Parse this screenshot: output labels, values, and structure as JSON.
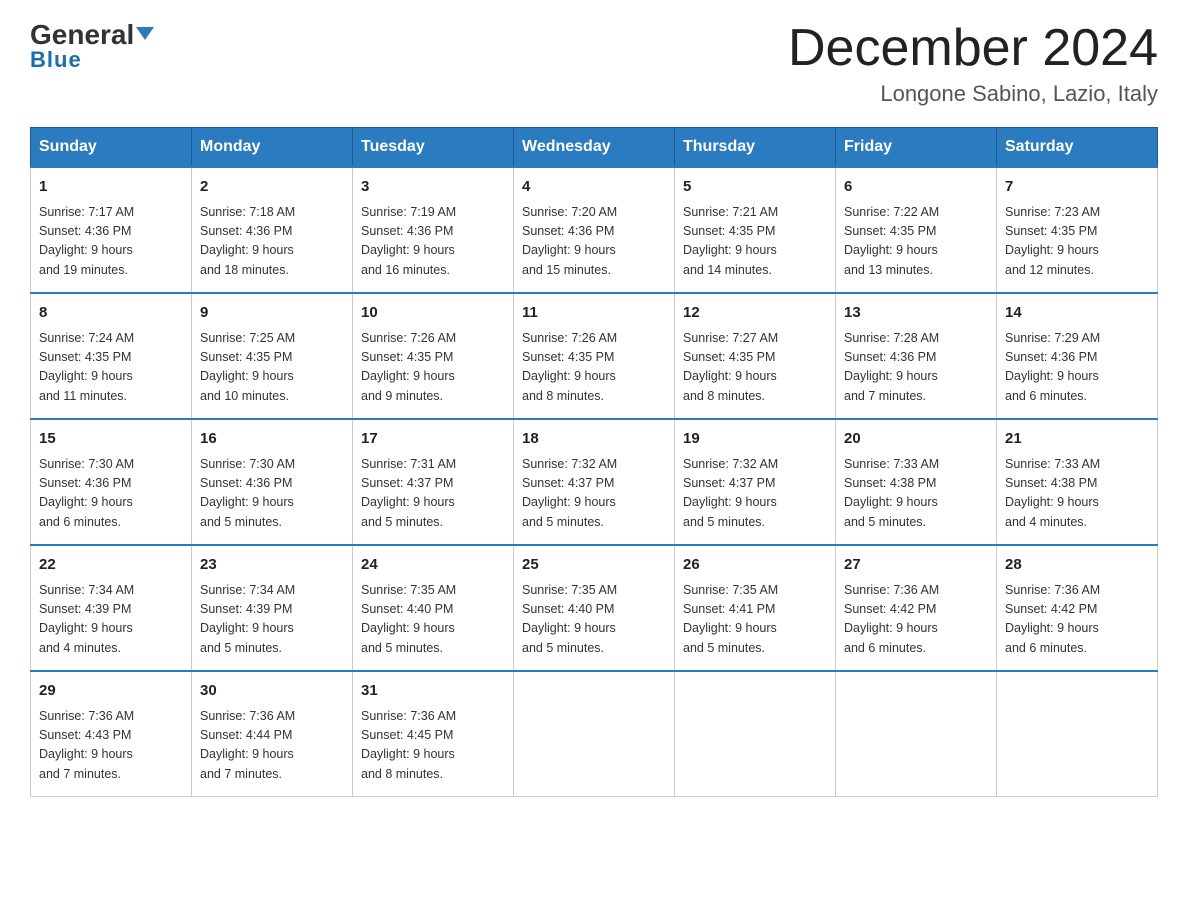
{
  "header": {
    "logo_general": "General",
    "logo_blue": "Blue",
    "month_title": "December 2024",
    "subtitle": "Longone Sabino, Lazio, Italy"
  },
  "days_of_week": [
    "Sunday",
    "Monday",
    "Tuesday",
    "Wednesday",
    "Thursday",
    "Friday",
    "Saturday"
  ],
  "weeks": [
    [
      {
        "num": "1",
        "sunrise": "7:17 AM",
        "sunset": "4:36 PM",
        "daylight": "9 hours and 19 minutes."
      },
      {
        "num": "2",
        "sunrise": "7:18 AM",
        "sunset": "4:36 PM",
        "daylight": "9 hours and 18 minutes."
      },
      {
        "num": "3",
        "sunrise": "7:19 AM",
        "sunset": "4:36 PM",
        "daylight": "9 hours and 16 minutes."
      },
      {
        "num": "4",
        "sunrise": "7:20 AM",
        "sunset": "4:36 PM",
        "daylight": "9 hours and 15 minutes."
      },
      {
        "num": "5",
        "sunrise": "7:21 AM",
        "sunset": "4:35 PM",
        "daylight": "9 hours and 14 minutes."
      },
      {
        "num": "6",
        "sunrise": "7:22 AM",
        "sunset": "4:35 PM",
        "daylight": "9 hours and 13 minutes."
      },
      {
        "num": "7",
        "sunrise": "7:23 AM",
        "sunset": "4:35 PM",
        "daylight": "9 hours and 12 minutes."
      }
    ],
    [
      {
        "num": "8",
        "sunrise": "7:24 AM",
        "sunset": "4:35 PM",
        "daylight": "9 hours and 11 minutes."
      },
      {
        "num": "9",
        "sunrise": "7:25 AM",
        "sunset": "4:35 PM",
        "daylight": "9 hours and 10 minutes."
      },
      {
        "num": "10",
        "sunrise": "7:26 AM",
        "sunset": "4:35 PM",
        "daylight": "9 hours and 9 minutes."
      },
      {
        "num": "11",
        "sunrise": "7:26 AM",
        "sunset": "4:35 PM",
        "daylight": "9 hours and 8 minutes."
      },
      {
        "num": "12",
        "sunrise": "7:27 AM",
        "sunset": "4:35 PM",
        "daylight": "9 hours and 8 minutes."
      },
      {
        "num": "13",
        "sunrise": "7:28 AM",
        "sunset": "4:36 PM",
        "daylight": "9 hours and 7 minutes."
      },
      {
        "num": "14",
        "sunrise": "7:29 AM",
        "sunset": "4:36 PM",
        "daylight": "9 hours and 6 minutes."
      }
    ],
    [
      {
        "num": "15",
        "sunrise": "7:30 AM",
        "sunset": "4:36 PM",
        "daylight": "9 hours and 6 minutes."
      },
      {
        "num": "16",
        "sunrise": "7:30 AM",
        "sunset": "4:36 PM",
        "daylight": "9 hours and 5 minutes."
      },
      {
        "num": "17",
        "sunrise": "7:31 AM",
        "sunset": "4:37 PM",
        "daylight": "9 hours and 5 minutes."
      },
      {
        "num": "18",
        "sunrise": "7:32 AM",
        "sunset": "4:37 PM",
        "daylight": "9 hours and 5 minutes."
      },
      {
        "num": "19",
        "sunrise": "7:32 AM",
        "sunset": "4:37 PM",
        "daylight": "9 hours and 5 minutes."
      },
      {
        "num": "20",
        "sunrise": "7:33 AM",
        "sunset": "4:38 PM",
        "daylight": "9 hours and 5 minutes."
      },
      {
        "num": "21",
        "sunrise": "7:33 AM",
        "sunset": "4:38 PM",
        "daylight": "9 hours and 4 minutes."
      }
    ],
    [
      {
        "num": "22",
        "sunrise": "7:34 AM",
        "sunset": "4:39 PM",
        "daylight": "9 hours and 4 minutes."
      },
      {
        "num": "23",
        "sunrise": "7:34 AM",
        "sunset": "4:39 PM",
        "daylight": "9 hours and 5 minutes."
      },
      {
        "num": "24",
        "sunrise": "7:35 AM",
        "sunset": "4:40 PM",
        "daylight": "9 hours and 5 minutes."
      },
      {
        "num": "25",
        "sunrise": "7:35 AM",
        "sunset": "4:40 PM",
        "daylight": "9 hours and 5 minutes."
      },
      {
        "num": "26",
        "sunrise": "7:35 AM",
        "sunset": "4:41 PM",
        "daylight": "9 hours and 5 minutes."
      },
      {
        "num": "27",
        "sunrise": "7:36 AM",
        "sunset": "4:42 PM",
        "daylight": "9 hours and 6 minutes."
      },
      {
        "num": "28",
        "sunrise": "7:36 AM",
        "sunset": "4:42 PM",
        "daylight": "9 hours and 6 minutes."
      }
    ],
    [
      {
        "num": "29",
        "sunrise": "7:36 AM",
        "sunset": "4:43 PM",
        "daylight": "9 hours and 7 minutes."
      },
      {
        "num": "30",
        "sunrise": "7:36 AM",
        "sunset": "4:44 PM",
        "daylight": "9 hours and 7 minutes."
      },
      {
        "num": "31",
        "sunrise": "7:36 AM",
        "sunset": "4:45 PM",
        "daylight": "9 hours and 8 minutes."
      },
      null,
      null,
      null,
      null
    ]
  ],
  "labels": {
    "sunrise": "Sunrise:",
    "sunset": "Sunset:",
    "daylight": "Daylight:"
  }
}
